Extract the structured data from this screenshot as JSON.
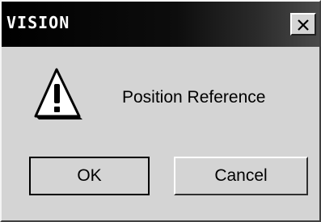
{
  "window": {
    "title": "VISION",
    "close_icon": "close-icon"
  },
  "dialog": {
    "icon": "warning-icon",
    "message": "Position Reference"
  },
  "buttons": {
    "ok_label": "OK",
    "cancel_label": "Cancel"
  },
  "colors": {
    "titlebar": "#000000",
    "face": "#d4d4d4",
    "text": "#000000"
  }
}
